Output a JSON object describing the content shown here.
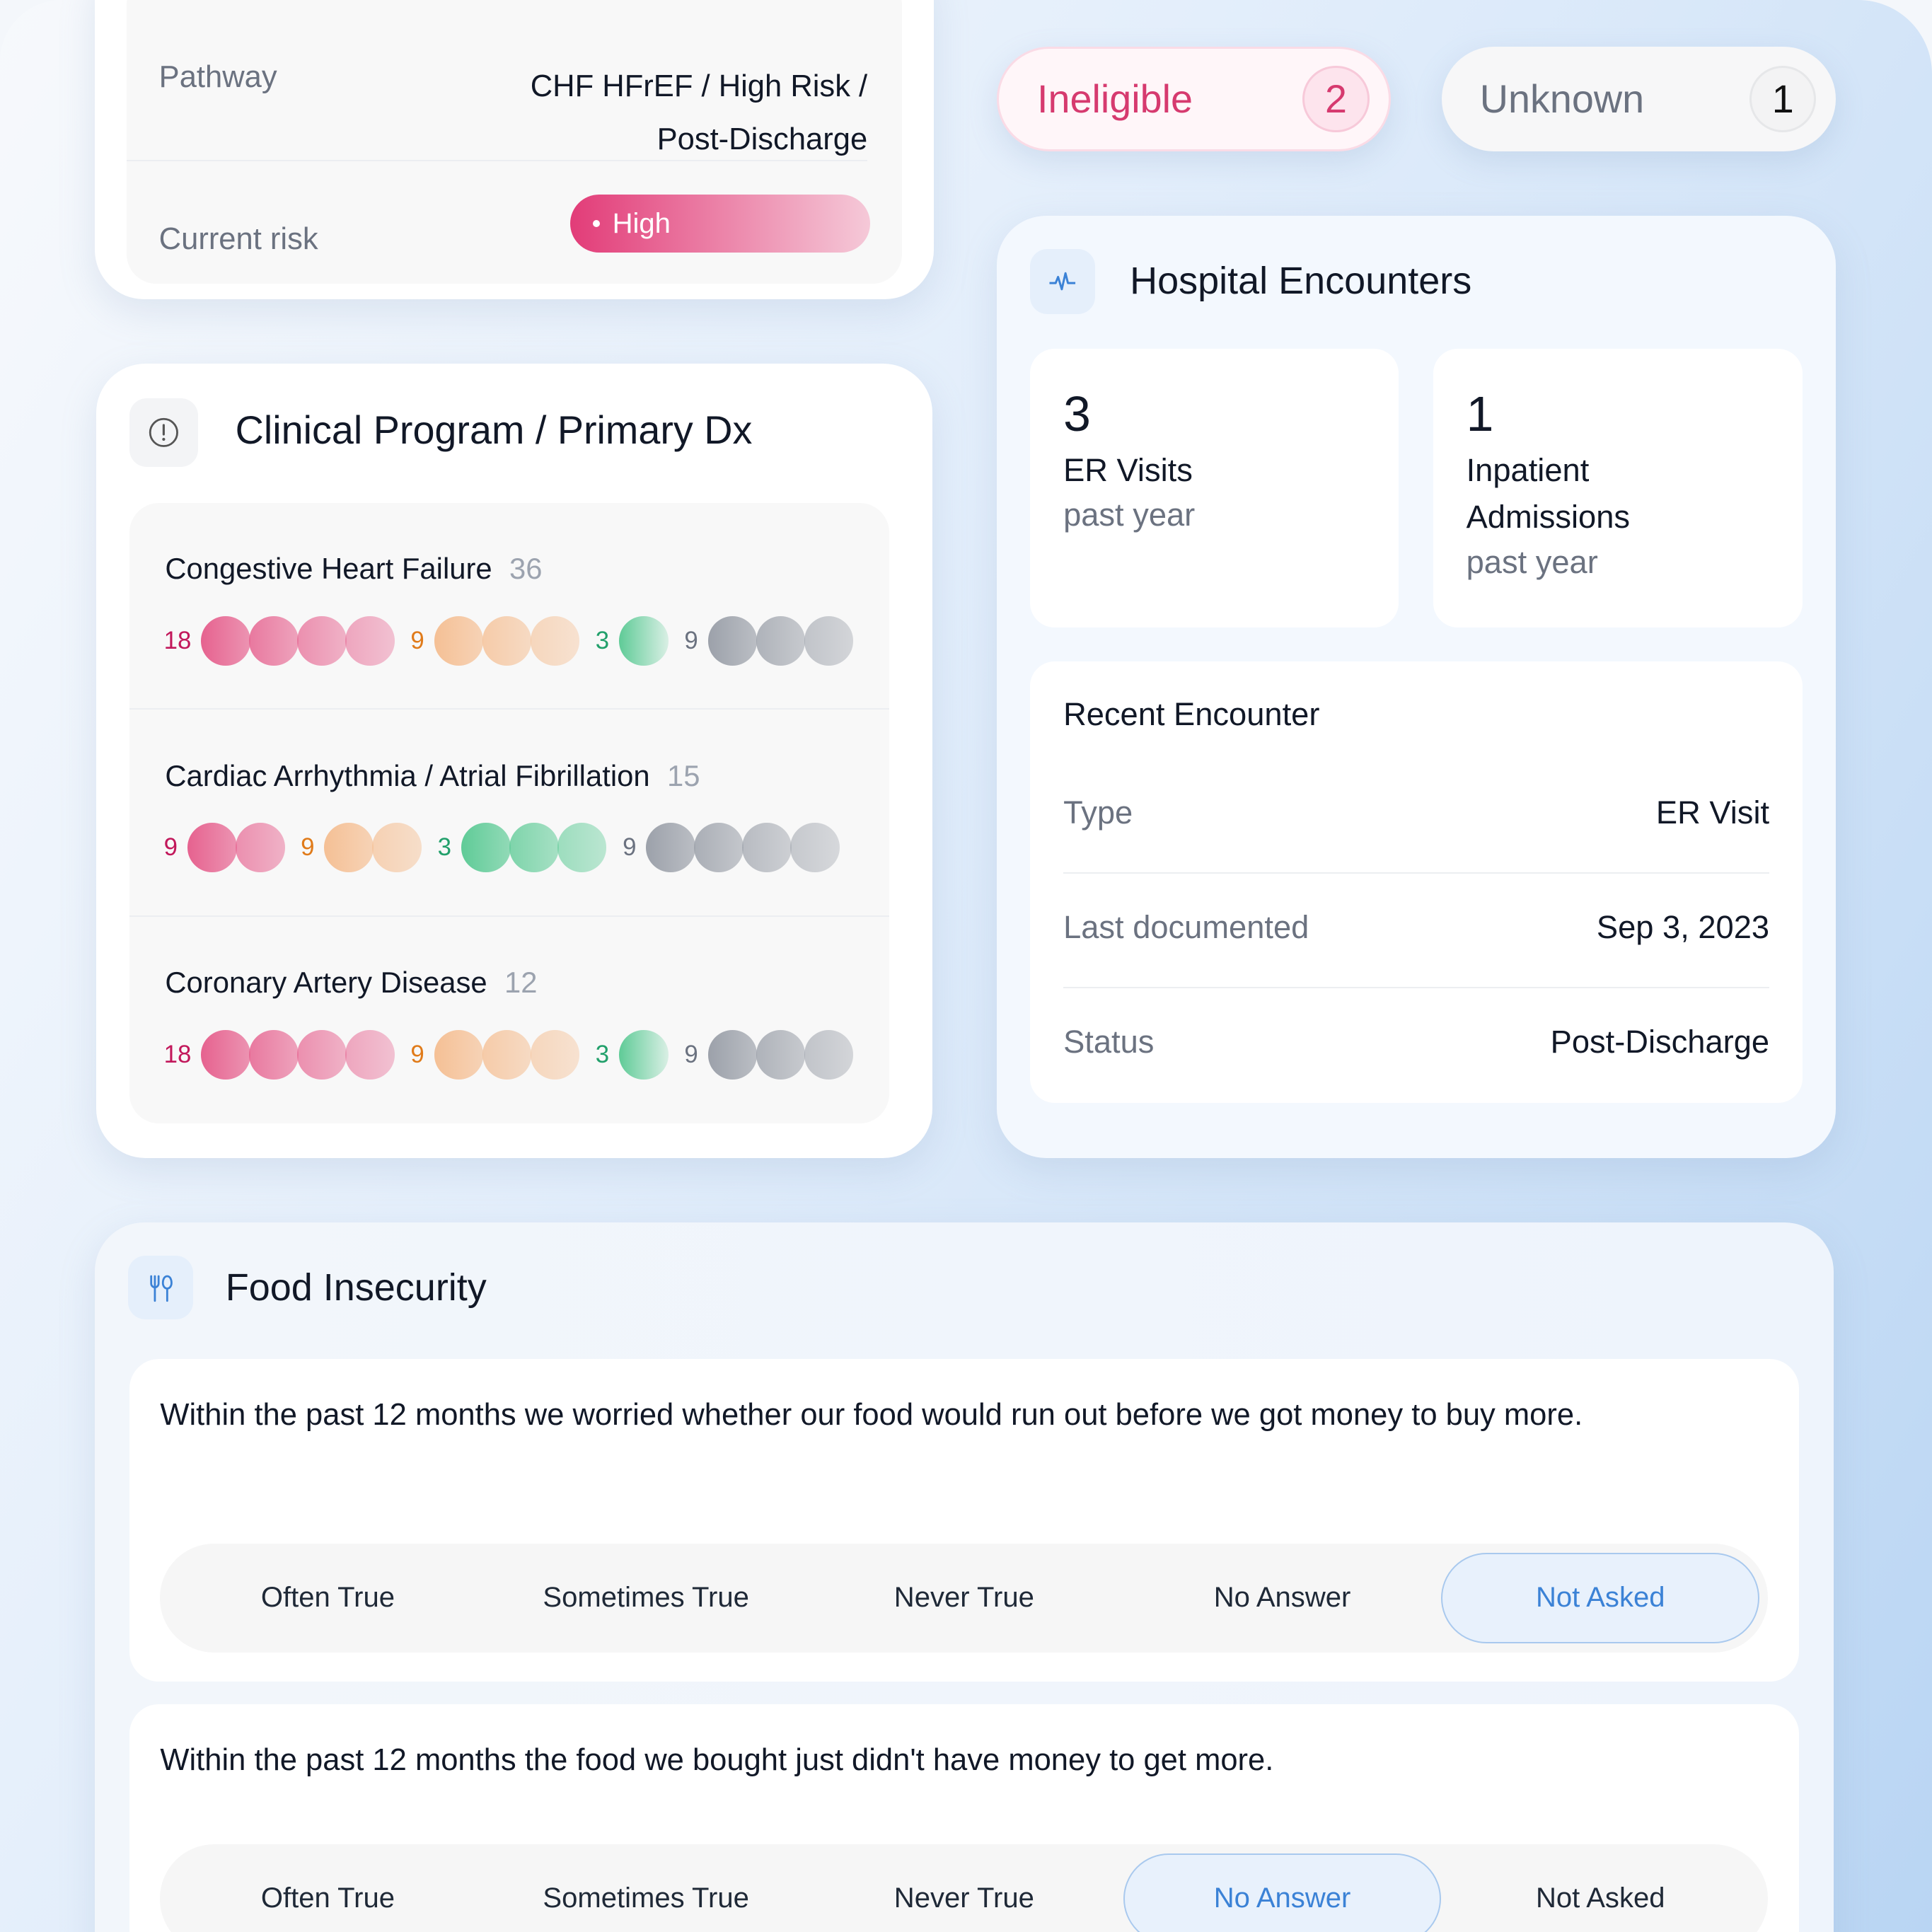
{
  "care_plan": {
    "pathway_label": "Pathway",
    "pathway_value_line1": "CHF HFrEF / High Risk /",
    "pathway_value_line2": "Post-Discharge",
    "risk_label": "Current risk",
    "risk_value": "High"
  },
  "status_pills": [
    {
      "label": "Ineligible",
      "count": "2"
    },
    {
      "label": "Unknown",
      "count": "1"
    }
  ],
  "clinical_program": {
    "title": "Clinical Program / Primary Dx",
    "icon": "info-circle-icon",
    "colors": {
      "pink": "#e6628f",
      "orange": "#f5c095",
      "green": "#5fcb97",
      "gray": "#9ca1aa"
    },
    "label_colors": {
      "pink": "#c2185b",
      "orange": "#e07b1a",
      "green": "#22a06b",
      "gray": "#6b7280"
    },
    "rows": [
      {
        "name": "Congestive Heart Failure",
        "count": "36",
        "groups": [
          {
            "color": "pink",
            "count": "18",
            "dots": 4
          },
          {
            "color": "orange",
            "count": "9",
            "dots": 3
          },
          {
            "color": "green",
            "count": "3",
            "dots": 1
          },
          {
            "color": "gray",
            "count": "9",
            "dots": 3
          }
        ]
      },
      {
        "name": "Cardiac Arrhythmia / Atrial Fibrillation",
        "count": "15",
        "groups": [
          {
            "color": "pink",
            "count": "9",
            "dots": 2
          },
          {
            "color": "orange",
            "count": "9",
            "dots": 2
          },
          {
            "color": "green",
            "count": "3",
            "dots": 3
          },
          {
            "color": "gray",
            "count": "9",
            "dots": 4
          }
        ]
      },
      {
        "name": "Coronary Artery Disease",
        "count": "12",
        "groups": [
          {
            "color": "pink",
            "count": "18",
            "dots": 4
          },
          {
            "color": "orange",
            "count": "9",
            "dots": 3
          },
          {
            "color": "green",
            "count": "3",
            "dots": 1
          },
          {
            "color": "gray",
            "count": "9",
            "dots": 3
          }
        ]
      }
    ]
  },
  "hospital": {
    "title": "Hospital Encounters",
    "icon": "activity-pulse-icon",
    "er": {
      "value": "3",
      "label": "ER Visits",
      "sub": "past year"
    },
    "inpatient": {
      "value": "1",
      "label_line1": "Inpatient",
      "label_line2": "Admissions",
      "sub": "past year"
    },
    "recent": {
      "title": "Recent Encounter",
      "rows": [
        {
          "label": "Type",
          "value": "ER Visit"
        },
        {
          "label": "Last documented",
          "value": "Sep 3, 2023"
        },
        {
          "label": "Status",
          "value": "Post-Discharge"
        }
      ]
    }
  },
  "food": {
    "title": "Food Insecurity",
    "icon": "utensils-icon",
    "options": [
      "Often True",
      "Sometimes True",
      "Never True",
      "No Answer",
      "Not Asked"
    ],
    "questions": [
      {
        "text": "Within the past 12 months we worried whether our food would run out before we got money to buy more.",
        "selected": "Not Asked"
      },
      {
        "text": "Within the past 12 months the food we bought just didn't have money to get more.",
        "selected": "No Answer"
      }
    ]
  }
}
